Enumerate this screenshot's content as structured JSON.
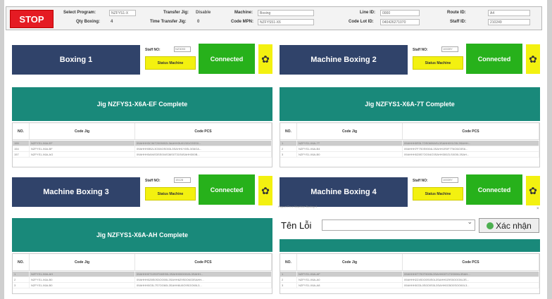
{
  "header": {
    "stop_label": "STOP",
    "select_program_label": "Select Program:",
    "select_program_value": "NZFYS1-X",
    "qty_boxing_label": "Qty Boxing:",
    "qty_boxing_value": "4",
    "transfer_jig_label": "Transfer Jig:",
    "transfer_jig_value": "Disable",
    "time_transfer_label": "Time Transfer Jig:",
    "time_transfer_value": "0",
    "machine_label": "Machine:",
    "machine_value": "Boxing",
    "code_mpn_label": "Code MPN:",
    "code_mpn_value": "NZFYS51-X6",
    "line_id_label": "Line ID:",
    "line_id_value": "0000",
    "code_lot_label": "Code Lot ID:",
    "code_lot_value": "040426271070",
    "route_id_label": "Route ID:",
    "route_id_value": "A4",
    "staff_id_label": "Staff ID:",
    "staff_id_value": "210249"
  },
  "stations": [
    {
      "name": "Boxing 1",
      "staff_label": "Staff NO:",
      "staff_value": "NZ3093",
      "status_btn": "Status Machine",
      "connection": "Connected",
      "jig_title": "Jig NZFYS1-X6A-EF Complete",
      "columns": [
        "NO.",
        "Code Jig",
        "Code PCS"
      ],
      "rows": [
        [
          "155",
          "NZFYS1-X6A-EF",
          "09AHHH3C36T2005002L3AAHH3U01301O3SS0..."
        ],
        [
          "154",
          "NZFYS1-X6A-BF",
          "09AHHH0B2L3OD6OS003L3SAHH1Y6SL3G6OA..."
        ],
        [
          "157",
          "NZFYS1-X6A-AG",
          "09AHHH0A94S3SS004S36S0T31S6SAHH300B..."
        ]
      ]
    },
    {
      "name": "Machine Boxing 2",
      "staff_label": "Staff NO:",
      "staff_value": "10039Y",
      "status_btn": "Status Machine",
      "connection": "Connected",
      "jig_title": "Jig NZFYS1-X6A-7T Complete",
      "columns": [
        "NO.",
        "Code Jig",
        "Code PCS"
      ],
      "rows": [
        [
          "1",
          "NZFYS1-X6A-7T",
          "09AHHH0R3L7OS0600ASL3SAHH001O3L3SAHH..."
        ],
        [
          "2",
          "NZFYS1-X6A-B4",
          "09AHHH7F7S0S9004L3SAHH1R0F7T6O6O3S6..."
        ],
        [
          "3",
          "NZFYS1-X6A-B0",
          "09AHHH0Z8S7OO04O3SAHH300ZLS0O0L3SAH..."
        ]
      ]
    },
    {
      "name": "Machine Boxing 3",
      "staff_label": "Staff NO:",
      "staff_value": "15128",
      "status_btn": "Status Machine",
      "connection": "Connected",
      "jig_title": "Jig NZFYS1-X6A-AH Complete",
      "columns": [
        "NO.",
        "Code Jig",
        "Code PCS"
      ],
      "rows": [
        [
          "1",
          "NZFYS1-X6A-AH",
          "09AHHH0T10S0T06SS0L3SAHH0000010L3SAHH..."
        ],
        [
          "2",
          "NZFYS1-X6A-B0",
          "09AHHH0Z8S0S3OO00L3SAHH6Z9S0O6O3SAHH..."
        ],
        [
          "3",
          "NZFYS1-X6A-B0",
          "09AHHH0O3L7S7OO60L3SAHH6U0O9SOO60L3..."
        ]
      ]
    },
    {
      "name": "Machine Boxing 4",
      "staff_label": "Staff NO:",
      "staff_value": "10039Y",
      "status_btn": "Status Machine",
      "connection": "Connected",
      "jig_title": "",
      "columns": [
        "NO.",
        "Code Jig",
        "Code PCS"
      ],
      "rows": [
        [
          "1",
          "NZFYS1-X6A-AF",
          "09AHHH0T7S0T9005L3SAHH00T1T0S006L3SAH..."
        ],
        [
          "2",
          "NZFYS1-X6A-A0",
          "09AHHH2Z4S0O0S0S0L3SAHH0Z9S0OOO6L3S..."
        ],
        [
          "3",
          "NZFYS1-X6A-A8",
          "09AHHH0O3L0S0O0S0L3SAHH0O5O0SOO60L3..."
        ]
      ]
    }
  ],
  "dialog": {
    "title": "Report Error Machine Boxing 4",
    "label": "Tên Lỗi",
    "button": "Xác nhận",
    "close": "×"
  },
  "colors": {
    "stop": "#e51b23",
    "panel": "#30436a",
    "connected": "#27b11b",
    "status": "#f3f110",
    "jig_header": "#19897a"
  }
}
